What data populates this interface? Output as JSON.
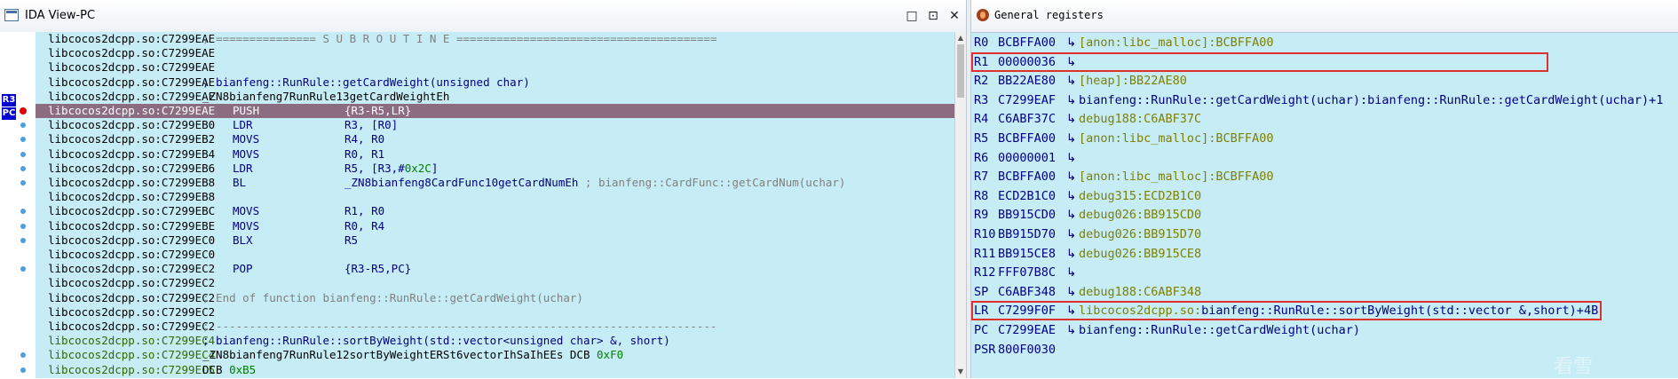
{
  "ida_view": {
    "title": "IDA View-PC",
    "buttons": {
      "restore": "□",
      "maximize": "⊡",
      "close": "✕"
    },
    "gutter_labels": {
      "r3": "R3",
      "pc": "PC"
    },
    "lines": [
      {
        "addr": "libcocos2dcpp.so:C7299EAE",
        "text": "; =============== S U B R O U T I N E =======================================",
        "kind": "comment"
      },
      {
        "addr": "libcocos2dcpp.so:C7299EAE",
        "text": "",
        "kind": "plain"
      },
      {
        "addr": "libcocos2dcpp.so:C7299EAE",
        "text": "",
        "kind": "plain"
      },
      {
        "addr": "libcocos2dcpp.so:C7299EAE",
        "text": "; bianfeng::RunRule::getCardWeight(unsigned char)",
        "kind": "blue"
      },
      {
        "addr": "libcocos2dcpp.so:C7299EAE",
        "text": "_ZN8bianfeng7RunRule13getCardWeightEh",
        "kind": "plain"
      },
      {
        "addr": "libcocos2dcpp.so:C7299EAE",
        "mn": "PUSH",
        "op": "{R3-R5,LR}",
        "kind": "current"
      },
      {
        "addr": "libcocos2dcpp.so:C7299EB0",
        "mn": "LDR",
        "op": "R3, [R0]",
        "kind": "ins"
      },
      {
        "addr": "libcocos2dcpp.so:C7299EB2",
        "mn": "MOVS",
        "op": "R4, R0",
        "kind": "ins"
      },
      {
        "addr": "libcocos2dcpp.so:C7299EB4",
        "mn": "MOVS",
        "op": "R0, R1",
        "kind": "ins"
      },
      {
        "addr": "libcocos2dcpp.so:C7299EB6",
        "mn": "LDR",
        "op": "R5, [R3,#",
        "op_hex": "0x2C",
        "op_tail": "]",
        "kind": "ins"
      },
      {
        "addr": "libcocos2dcpp.so:C7299EB8",
        "mn": "BL",
        "op": "_ZN8bianfeng8CardFunc10getCardNumEh",
        "op_cmt": " ; bianfeng::CardFunc::getCardNum(uchar)",
        "kind": "ins"
      },
      {
        "addr": "libcocos2dcpp.so:C7299EB8",
        "text": "",
        "kind": "plain"
      },
      {
        "addr": "libcocos2dcpp.so:C7299EBC",
        "mn": "MOVS",
        "op": "R1, R0",
        "kind": "ins"
      },
      {
        "addr": "libcocos2dcpp.so:C7299EBE",
        "mn": "MOVS",
        "op": "R0, R4",
        "kind": "ins"
      },
      {
        "addr": "libcocos2dcpp.so:C7299EC0",
        "mn": "BLX",
        "op": "R5",
        "kind": "ins"
      },
      {
        "addr": "libcocos2dcpp.so:C7299EC0",
        "text": "",
        "kind": "plain"
      },
      {
        "addr": "libcocos2dcpp.so:C7299EC2",
        "mn": "POP",
        "op": "{R3-R5,PC}",
        "kind": "ins"
      },
      {
        "addr": "libcocos2dcpp.so:C7299EC2",
        "text": "",
        "kind": "plain"
      },
      {
        "addr": "libcocos2dcpp.so:C7299EC2",
        "text": "; End of function bianfeng::RunRule::getCardWeight(uchar)",
        "kind": "comment"
      },
      {
        "addr": "libcocos2dcpp.so:C7299EC2",
        "text": "",
        "kind": "plain"
      },
      {
        "addr": "libcocos2dcpp.so:C7299EC2",
        "text": "; ---------------------------------------------------------------------------",
        "kind": "comment"
      },
      {
        "addr": "libcocos2dcpp.so:C7299EC4",
        "text": "; bianfeng::RunRule::sortByWeight(std::vector<unsigned char> &, short)",
        "kind": "blue",
        "green_addr": true
      },
      {
        "addr": "libcocos2dcpp.so:C7299EC4",
        "text": "_ZN8bianfeng7RunRule12sortByWeightERSt6vectorIhSaIhEEs DCB ",
        "hex": "0xF0",
        "kind": "plain",
        "green_addr": true
      },
      {
        "addr": "libcocos2dcpp.so:C7299EC5",
        "text": "DCB ",
        "hex": "0xB5",
        "kind": "plain",
        "green_addr": true
      }
    ]
  },
  "registers": {
    "title": "General registers",
    "arrow": "↳",
    "rows": [
      {
        "name": "R0",
        "value": "BCBFFA00",
        "desc": "[anon:libc_malloc]:BCBFFA00"
      },
      {
        "name": "R1",
        "value": "00000036",
        "desc": ""
      },
      {
        "name": "R2",
        "value": "BB22AE80",
        "desc": "[heap]:BB22AE80"
      },
      {
        "name": "R3",
        "value": "C7299EAF",
        "desc": "bianfeng::RunRule::getCardWeight(uchar):bianfeng::RunRule::getCardWeight(uchar)+1",
        "desc_blue": true
      },
      {
        "name": "R4",
        "value": "C6ABF37C",
        "desc": "debug188:C6ABF37C"
      },
      {
        "name": "R5",
        "value": "BCBFFA00",
        "desc": "[anon:libc_malloc]:BCBFFA00"
      },
      {
        "name": "R6",
        "value": "00000001",
        "desc": ""
      },
      {
        "name": "R7",
        "value": "BCBFFA00",
        "desc": "[anon:libc_malloc]:BCBFFA00"
      },
      {
        "name": "R8",
        "value": "ECD2B1C0",
        "desc": "debug315:ECD2B1C0"
      },
      {
        "name": "R9",
        "value": "BB915CD0",
        "desc": "debug026:BB915CD0"
      },
      {
        "name": "R10",
        "value": "BB915D70",
        "desc": "debug026:BB915D70"
      },
      {
        "name": "R11",
        "value": "BB915CE8",
        "desc": "debug026:BB915CE8"
      },
      {
        "name": "R12",
        "value": "FFF07B8C",
        "desc": ""
      },
      {
        "name": "SP",
        "value": "C6ABF348",
        "desc": "debug188:C6ABF348"
      },
      {
        "name": "LR",
        "value": "C7299F0F",
        "desc_lib": "libcocos2dcpp.so:",
        "desc": "bianfeng::RunRule::sortByWeight(std::vector &,short)+4B",
        "desc_blue": true
      },
      {
        "name": "PC",
        "value": "C7299EAE",
        "desc": "bianfeng::RunRule::getCardWeight(uchar)",
        "desc_blue": true
      },
      {
        "name": "PSR",
        "value": "800F0030",
        "desc": "",
        "no_arrow": true
      }
    ]
  },
  "watermark": "看雪",
  "colors": {
    "background": "#c6ecf5",
    "current_line": "#8c6c80",
    "highlight": "#e03030"
  }
}
